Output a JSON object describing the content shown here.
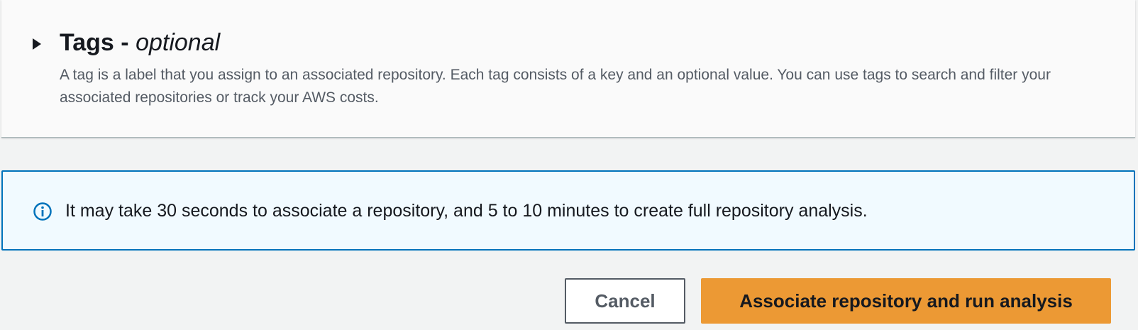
{
  "tags_section": {
    "title": "Tags -",
    "title_optional": "optional",
    "description": "A tag is a label that you assign to an associated repository. Each tag consists of a key and an optional value. You can use tags to search and filter your associated repositories or track your AWS costs.",
    "expand_icon": "caret-right-icon",
    "expanded": false
  },
  "info_alert": {
    "icon": "info-circle-icon",
    "message": "It may take 30 seconds to associate a repository, and 5 to 10 minutes to create full repository analysis.",
    "border_color": "#0073bb",
    "background_color": "#f1faff"
  },
  "actions": {
    "cancel_label": "Cancel",
    "submit_label": "Associate repository and run analysis",
    "primary_color": "#ec9934"
  }
}
